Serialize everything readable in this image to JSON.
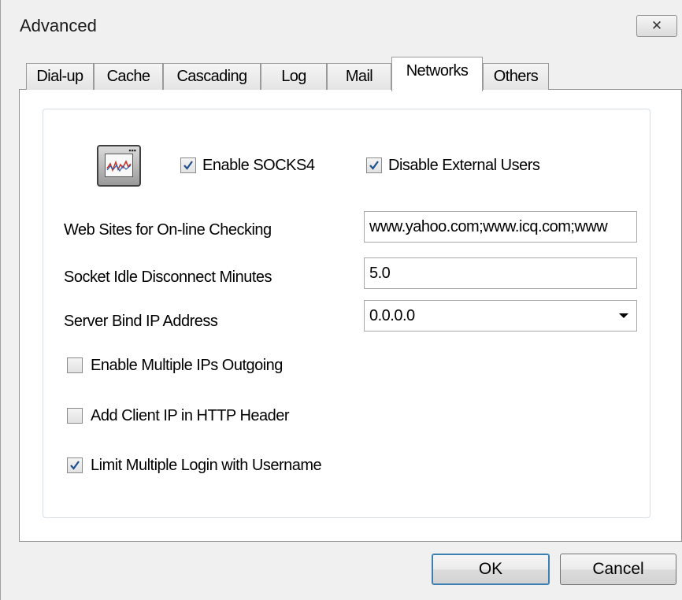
{
  "window": {
    "title": "Advanced",
    "close_glyph": "✕"
  },
  "tabs": [
    {
      "label": "Dial-up",
      "active": false
    },
    {
      "label": "Cache",
      "active": false
    },
    {
      "label": "Cascading",
      "active": false
    },
    {
      "label": "Log",
      "active": false
    },
    {
      "label": "Mail",
      "active": false
    },
    {
      "label": "Networks",
      "active": true
    },
    {
      "label": "Others",
      "active": false
    }
  ],
  "networks": {
    "icon": "network-monitor-icon",
    "enable_socks4": {
      "label": "Enable SOCKS4",
      "checked": true
    },
    "disable_external_users": {
      "label": "Disable External Users",
      "checked": true
    },
    "web_sites_online_checking": {
      "label": "Web Sites for On-line Checking",
      "value": "www.yahoo.com;www.icq.com;www"
    },
    "socket_idle_disconnect_minutes": {
      "label": "Socket Idle Disconnect Minutes",
      "value": "5.0"
    },
    "server_bind_ip_address": {
      "label": "Server Bind IP Address",
      "selected": "0.0.0.0"
    },
    "enable_multiple_ips_outgoing": {
      "label": "Enable Multiple IPs Outgoing",
      "checked": false
    },
    "add_client_ip_http_header": {
      "label": "Add Client IP in HTTP Header",
      "checked": false
    },
    "limit_multiple_login": {
      "label": "Limit Multiple Login with Username",
      "checked": true
    }
  },
  "buttons": {
    "ok": "OK",
    "cancel": "Cancel"
  },
  "colors": {
    "check": "#1f4f8c",
    "focus_border": "#3c7fb1"
  }
}
